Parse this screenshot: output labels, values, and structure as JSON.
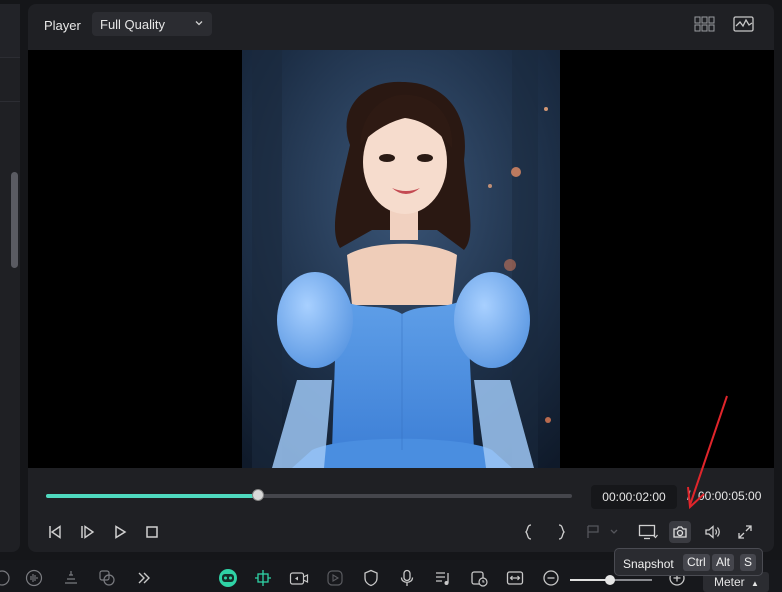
{
  "player": {
    "title": "Player",
    "quality": "Full Quality",
    "current_time": "00:00:02:00",
    "separator": "/",
    "total_time": "00:00:05:00",
    "progress_fraction": 0.403
  },
  "tooltip": {
    "label": "Snapshot",
    "keys": [
      "Ctrl",
      "Alt",
      "S"
    ]
  },
  "toolbar": {
    "meter_label": "Meter",
    "zoom_fraction": 0.5
  },
  "colors": {
    "accent": "#4fd9bf",
    "annotation_arrow": "#e0252b"
  }
}
